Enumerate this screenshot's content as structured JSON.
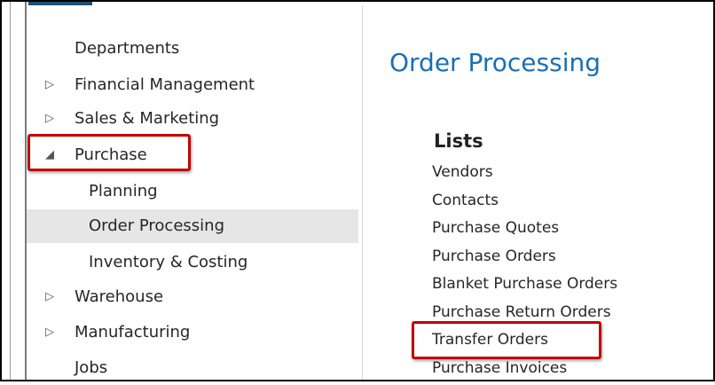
{
  "nav": {
    "items": [
      {
        "label": "Departments",
        "arrow": ""
      },
      {
        "label": "Financial Management",
        "arrow": "▷"
      },
      {
        "label": "Sales & Marketing",
        "arrow": "▷"
      },
      {
        "label": "Purchase",
        "arrow": "◢"
      },
      {
        "label": "Planning",
        "arrow": ""
      },
      {
        "label": "Order Processing",
        "arrow": ""
      },
      {
        "label": "Inventory & Costing",
        "arrow": ""
      },
      {
        "label": "Warehouse",
        "arrow": "▷"
      },
      {
        "label": "Manufacturing",
        "arrow": "▷"
      },
      {
        "label": "Jobs",
        "arrow": ""
      }
    ],
    "selected": "Order Processing"
  },
  "content": {
    "title": "Order Processing",
    "lists_heading": "Lists",
    "links": [
      "Vendors",
      "Contacts",
      "Purchase Quotes",
      "Purchase Orders",
      "Blanket Purchase Orders",
      "Purchase Return Orders",
      "Transfer Orders",
      "Purchase Invoices"
    ]
  },
  "colors": {
    "title_blue": "#1a6fb5",
    "highlight_red": "#c00000",
    "selected_bg": "#e6e6e6"
  }
}
